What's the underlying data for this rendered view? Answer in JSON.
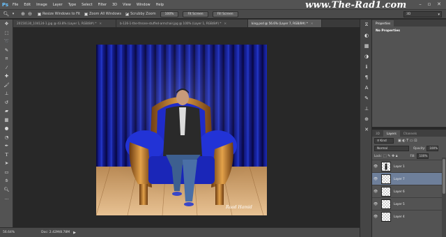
{
  "app": {
    "logo": "Ps",
    "watermark": "www.The-Rad1.com"
  },
  "menu": [
    "File",
    "Edit",
    "Image",
    "Layer",
    "Type",
    "Select",
    "Filter",
    "3D",
    "View",
    "Window",
    "Help"
  ],
  "options": {
    "resize_windows": "Resize Windows to Fit",
    "zoom_all": "Zoom All Windows",
    "scrubby": "Scrubby Zoom",
    "zoom_100": "100%",
    "fit_screen": "Fit Screen",
    "fill_screen": "Fill Screen",
    "workspace": "3D"
  },
  "tabs": [
    {
      "label": "20150130_104124-1.jpg @ 43.8% (Layer 1, RGB/8#) *",
      "active": false
    },
    {
      "label": "b-126-1-the-throne-stuffed-armchair.jpg @ 100% (Layer 1, RGB/8#) *",
      "active": false
    },
    {
      "label": "king.psd @ 56.6% (Layer 7, RGB/8#) *",
      "active": true
    }
  ],
  "artwork": {
    "signature": "Raad Hamid"
  },
  "status": {
    "zoom": "56.64%",
    "doc": "Doc: 2.42M/8.78M"
  },
  "properties": {
    "tab": "Properties",
    "title": "No Properties"
  },
  "layers_panel": {
    "tabs": [
      "3D",
      "Layers",
      "Channels"
    ],
    "filter": "Kind",
    "blend_mode": "Normal",
    "opacity_label": "Opacity:",
    "opacity": "100%",
    "lock_label": "Lock:",
    "fill_label": "Fill:",
    "fill": "100%",
    "layers": [
      {
        "name": "Layer 1",
        "selected": false
      },
      {
        "name": "Layer 7",
        "selected": true
      },
      {
        "name": "Layer 6",
        "selected": false
      },
      {
        "name": "Layer 5",
        "selected": false
      },
      {
        "name": "Layer 4",
        "selected": false
      }
    ]
  }
}
